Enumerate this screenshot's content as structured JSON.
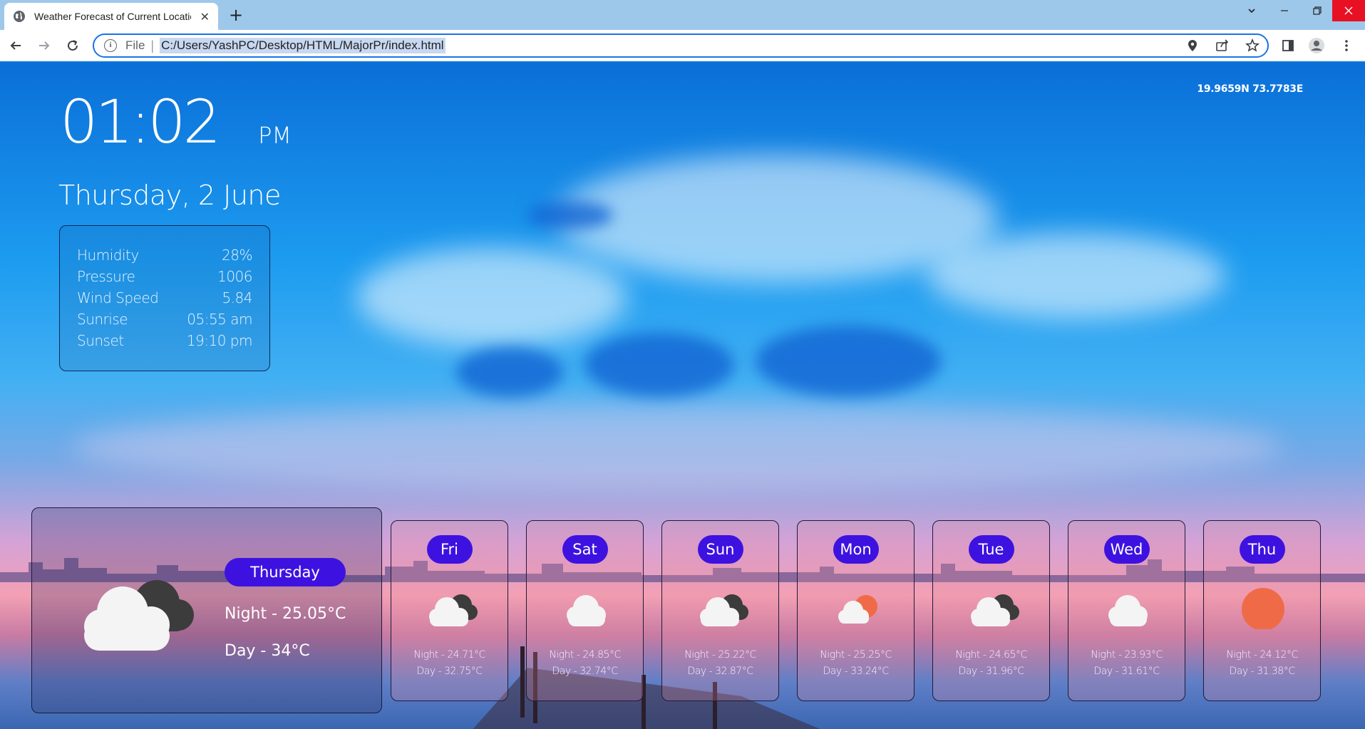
{
  "browser": {
    "tab_title": "Weather Forecast of Current Location",
    "tab_close": "✕",
    "new_tab": "+",
    "omnibox_scheme": "File",
    "url": "C:/Users/YashPC/Desktop/HTML/MajorPr/index.html"
  },
  "clock": {
    "time": "01:02",
    "ampm": "PM"
  },
  "date": "Thursday, 2 June",
  "location": {
    "coords": "19.9659N 73.7783E"
  },
  "details": [
    {
      "label": "Humidity",
      "value": "28%"
    },
    {
      "label": "Pressure",
      "value": "1006"
    },
    {
      "label": "Wind Speed",
      "value": "5.84"
    },
    {
      "label": "Sunrise",
      "value": "05:55 am"
    },
    {
      "label": "Sunset",
      "value": "19:10 pm"
    }
  ],
  "today": {
    "day": "Thursday",
    "night": "Night - 25.05°C",
    "day_temp": "Day - 34°C",
    "icon": "broken-clouds-icon"
  },
  "forecast": [
    {
      "day": "Fri",
      "night": "Night - 24.71°C",
      "day_temp": "Day - 32.75°C",
      "icon": "broken-clouds-icon"
    },
    {
      "day": "Sat",
      "night": "Night - 24.85°C",
      "day_temp": "Day - 32.74°C",
      "icon": "cloud-icon"
    },
    {
      "day": "Sun",
      "night": "Night - 25.22°C",
      "day_temp": "Day - 32.87°C",
      "icon": "broken-clouds-icon"
    },
    {
      "day": "Mon",
      "night": "Night - 25.25°C",
      "day_temp": "Day - 33.24°C",
      "icon": "partly-sunny-icon"
    },
    {
      "day": "Tue",
      "night": "Night - 24.65°C",
      "day_temp": "Day - 31.96°C",
      "icon": "broken-clouds-icon"
    },
    {
      "day": "Wed",
      "night": "Night - 23.93°C",
      "day_temp": "Day - 31.61°C",
      "icon": "cloud-icon"
    },
    {
      "day": "Thu",
      "night": "Night - 24.12°C",
      "day_temp": "Day - 31.38°C",
      "icon": "sun-icon"
    }
  ],
  "colors": {
    "pill": "#3d12e0",
    "sun": "#ef6b48",
    "cloud_light": "#f4f4f4",
    "cloud_dark": "#3c3c3c"
  }
}
